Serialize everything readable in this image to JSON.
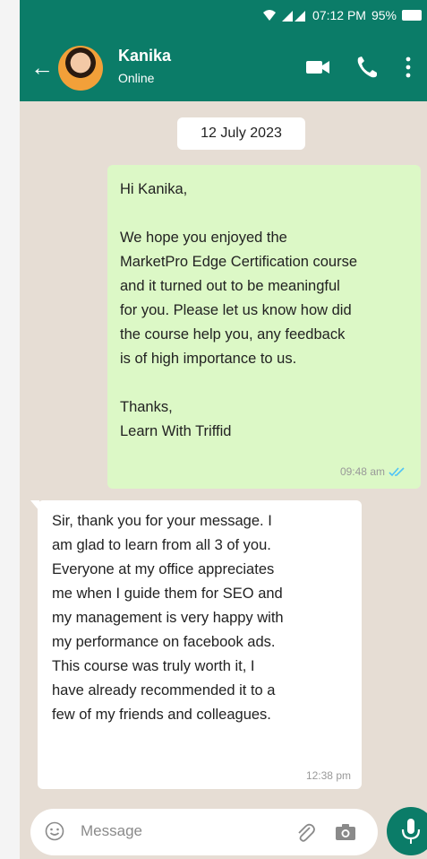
{
  "status_bar": {
    "time": "07:12 PM",
    "battery": "95%"
  },
  "header": {
    "contact_name": "Kanika",
    "presence": "Online"
  },
  "date_separator": "12 July 2023",
  "messages": [
    {
      "direction": "out",
      "lines": [
        "Hi Kanika,",
        "",
        "We hope you enjoyed the",
        "MarketPro Edge Certification course",
        "and it turned out to be meaningful",
        "for you. Please let us know how did",
        "the course help you, any feedback",
        "is of high importance to us.",
        "",
        "Thanks,",
        "Learn With Triffid"
      ],
      "time": "09:48 am"
    },
    {
      "direction": "in",
      "lines": [
        "Sir, thank you for your message. I",
        "am glad to learn from all 3 of you.",
        "Everyone at my office appreciates",
        "me when I guide them for SEO and",
        "my management is very happy with",
        "my performance on facebook ads.",
        "This course was truly worth it, I",
        "have already recommended it to a",
        "few of my friends and colleagues."
      ],
      "time": "12:38 pm"
    }
  ],
  "composer": {
    "placeholder": "Message"
  },
  "colors": {
    "header": "#0b7c68",
    "outgoing_bubble": "#dcf8c6",
    "chat_background": "#e6ddd4",
    "read_ticks": "#4fc3f7"
  },
  "icons": [
    "wifi-icon",
    "signal-icon",
    "battery-icon",
    "back-arrow-icon",
    "video-call-icon",
    "phone-icon",
    "more-vertical-icon",
    "double-check-icon",
    "emoji-icon",
    "attach-icon",
    "camera-icon",
    "mic-icon"
  ]
}
